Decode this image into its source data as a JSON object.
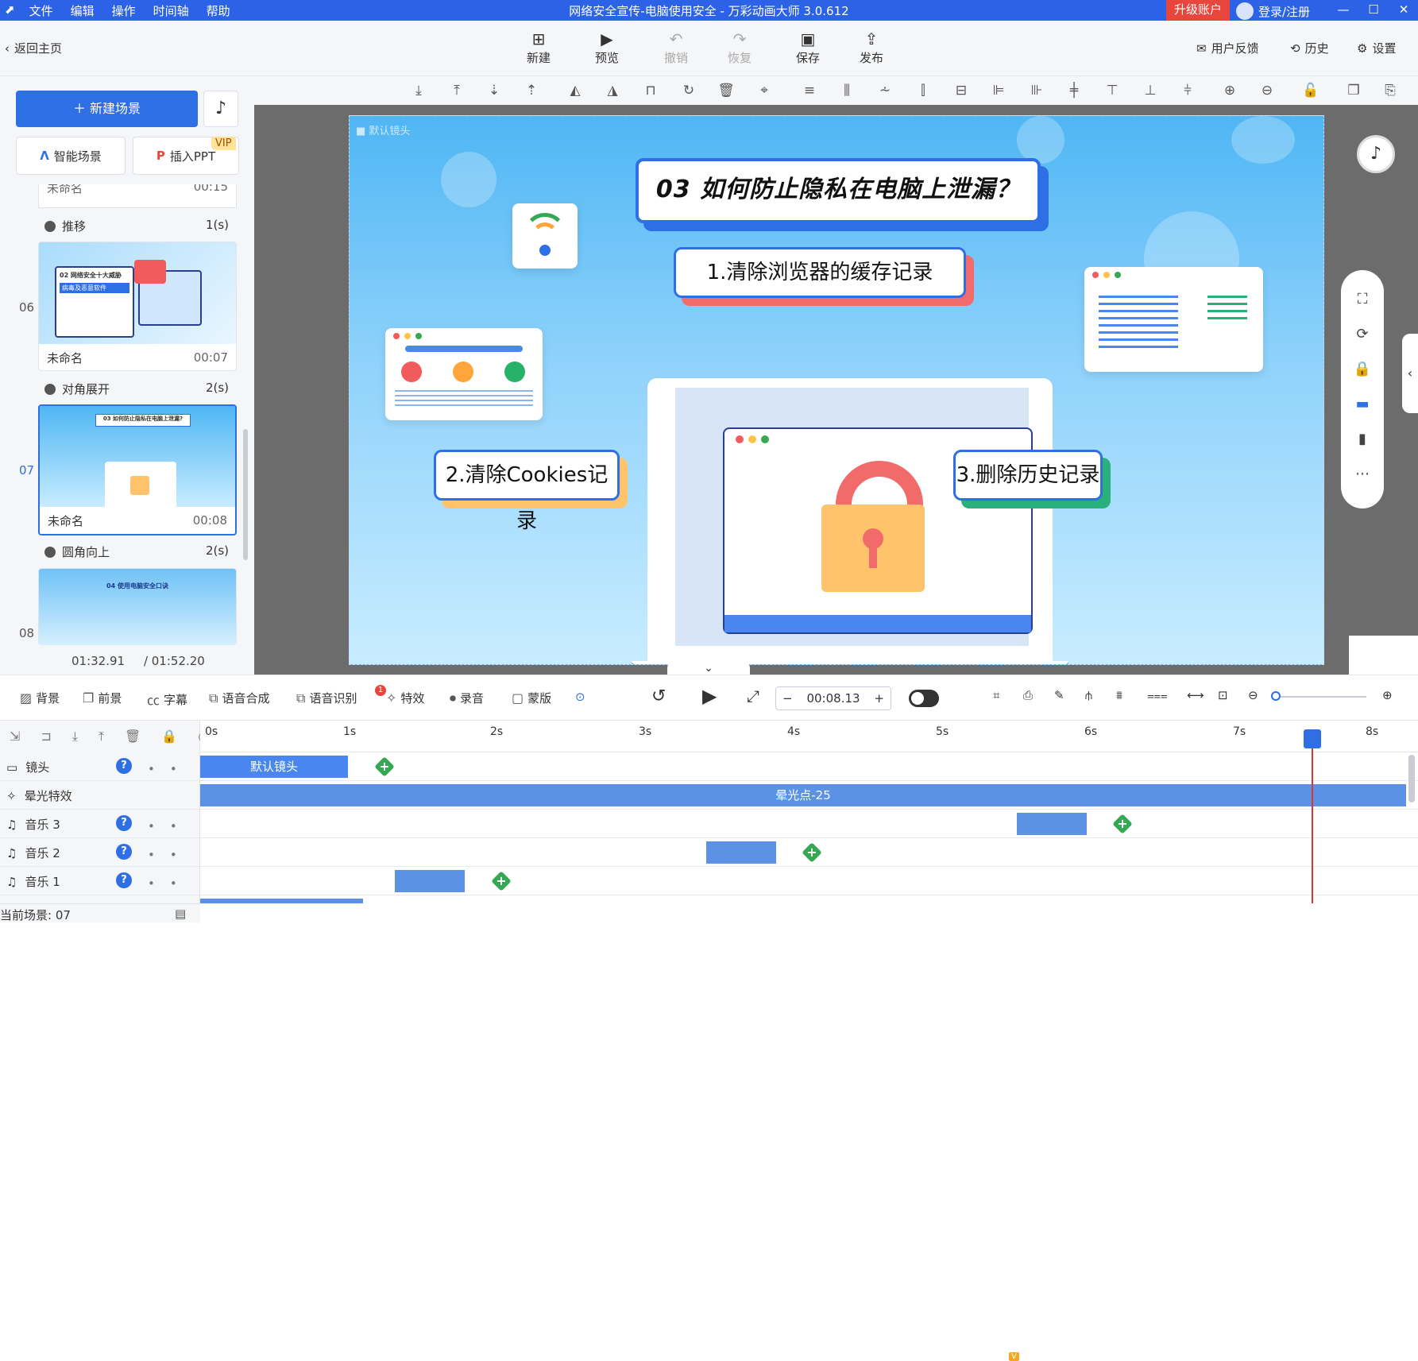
{
  "titlebar": {
    "menu": [
      "文件",
      "编辑",
      "操作",
      "时间轴",
      "帮助"
    ],
    "title": "网络安全宣传-电脑使用安全 - 万彩动画大师 3.0.612",
    "upgrade": "升级账户",
    "login": "登录/注册"
  },
  "toolbar": {
    "back": "返回主页",
    "new": "新建",
    "preview": "预览",
    "undo": "撤销",
    "redo": "恢复",
    "save": "保存",
    "publish": "发布",
    "feedback": "用户反馈",
    "history": "历史",
    "settings": "设置"
  },
  "left": {
    "new_scene": "新建场景",
    "smart_scene": "智能场景",
    "insert_ppt": "插入PPT",
    "vip": "VIP",
    "partial_card": {
      "name": "未命名",
      "time": "00:15"
    },
    "scenes": [
      {
        "num": "06",
        "transition": "推移",
        "trans_time": "1(s)",
        "name": "未命名",
        "time": "00:07"
      },
      {
        "num": "07",
        "transition": "对角展开",
        "trans_time": "2(s)",
        "name": "未命名",
        "time": "00:08"
      },
      {
        "num": "08",
        "transition": "圆角向上",
        "trans_time": "2(s)",
        "name": "",
        "time": ""
      }
    ],
    "thumb_texts": {
      "s06_title": "02 网络安全十大威胁",
      "s06_tag": "病毒及恶意软件",
      "s07_title": "03 如何防止隐私在电脑上泄漏?",
      "s08_title": "04 使用电脑安全口诀"
    },
    "current_time": "01:32.91",
    "total_time": "/ 01:52.20"
  },
  "stage": {
    "camera_label": "默认镜头",
    "title": "03  如何防止隐私在电脑上泄漏？",
    "label1": "1.清除浏览器的缓存记录",
    "label2": "2.清除Cookies记录",
    "label3": "3.删除历史记录"
  },
  "bottom": {
    "background": "背景",
    "foreground": "前景",
    "subtitle": "字幕",
    "tts": "语音合成",
    "asr": "语音识别",
    "asr_badge": "1",
    "effects": "特效",
    "record": "录音",
    "mask": "蒙版",
    "time": "00:08.13",
    "vbadge": "V"
  },
  "timeline": {
    "ticks": [
      "0s",
      "1s",
      "2s",
      "3s",
      "4s",
      "5s",
      "6s",
      "7s",
      "8s"
    ],
    "tracks": [
      {
        "name": "镜头",
        "segment": "默认镜头"
      },
      {
        "name": "晕光特效",
        "segment": "晕光点-25"
      },
      {
        "name": "音乐 3"
      },
      {
        "name": "音乐 2"
      },
      {
        "name": "音乐 1"
      }
    ],
    "current_scene": "当前场景: 07"
  },
  "colors": {
    "accent": "#2e6fe6",
    "stage_bg": "#4fb6f4",
    "clip": "#5b92e5",
    "keyframe": "#35a853",
    "playhead": "#dd3333"
  }
}
